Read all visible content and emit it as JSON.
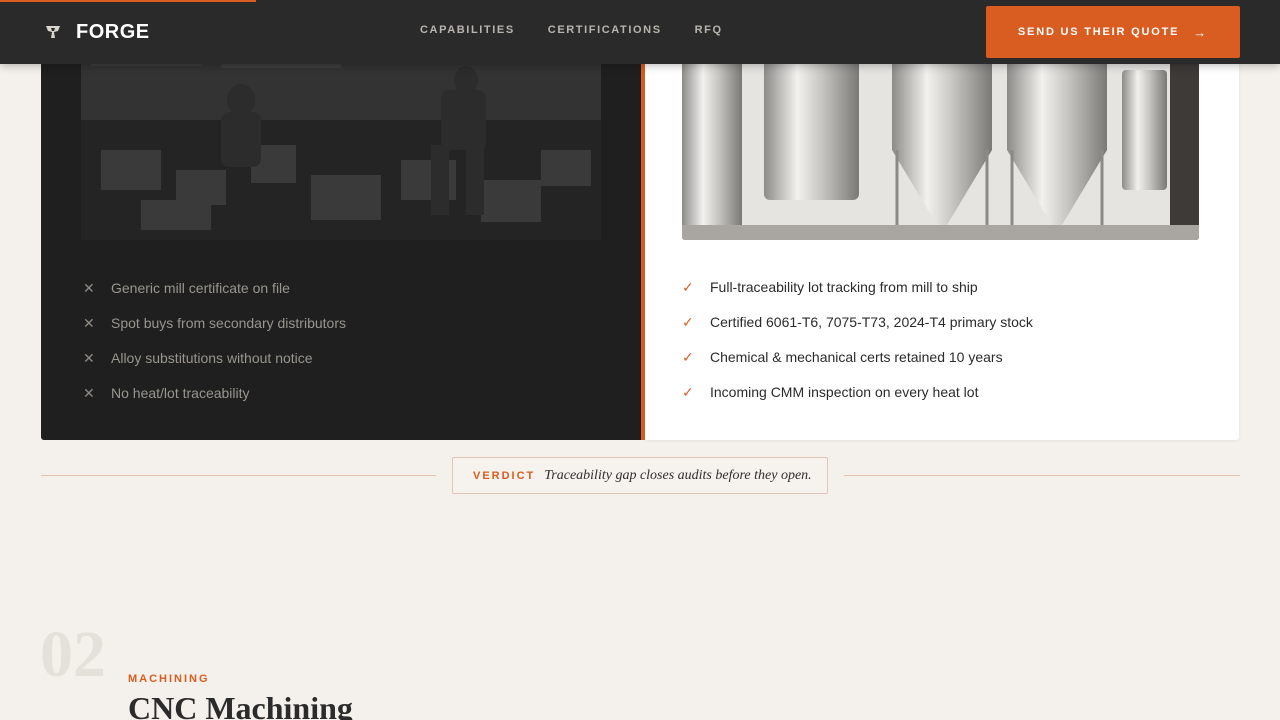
{
  "nav": {
    "brand": "FORGE",
    "links": [
      "CAPABILITIES",
      "CERTIFICATIONS",
      "RFQ"
    ],
    "cta_label": "SEND US THEIR QUOTE",
    "cta_icon": "arrow-right-icon",
    "progress_fraction": 0.2
  },
  "comparison": {
    "theirs": {
      "image": "warehouse-photo",
      "items": [
        "Generic mill certificate on file",
        "Spot buys from secondary distributors",
        "Alloy substitutions without notice",
        "No heat/lot traceability"
      ],
      "mark": "✕"
    },
    "ours": {
      "image": "steel-tanks-photo",
      "items": [
        "Full-traceability lot tracking from mill to ship",
        "Certified 6061-T6, 7075-T73, 2024-T4 primary stock",
        "Chemical & mechanical certs retained 10 years",
        "Incoming CMM inspection on every heat lot"
      ],
      "mark": "✓"
    }
  },
  "verdict": {
    "label": "VERDICT",
    "text": "Traceability gap closes audits before they open."
  },
  "next_section": {
    "number": "02",
    "eyebrow": "MACHINING",
    "title": "CNC Machining"
  },
  "colors": {
    "accent": "#d95d20",
    "nav_bg": "#2a2a2a",
    "page_bg": "#f4f0eb",
    "dark_panel": "#1f1f1f"
  }
}
